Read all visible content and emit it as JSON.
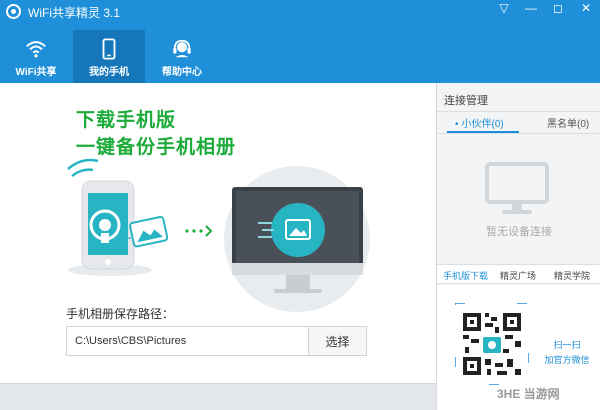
{
  "window": {
    "title": "WiFi共享精灵 3.1",
    "buttons": {
      "menu": "▽",
      "minimize": "—",
      "maximize": "◻",
      "close": "✕"
    }
  },
  "nav": {
    "items": [
      {
        "label": "WiFi共享",
        "icon": "wifi-icon"
      },
      {
        "label": "我的手机",
        "icon": "phone-icon",
        "active": true
      },
      {
        "label": "帮助中心",
        "icon": "headset-icon"
      }
    ]
  },
  "main": {
    "promo_line1": "下载手机版",
    "promo_line2": "一键备份手机相册",
    "path_label": "手机相册保存路径：",
    "path_value": "C:\\Users\\CBS\\Pictures",
    "choose_label": "选择"
  },
  "side": {
    "title": "连接管理",
    "tabs": {
      "partner": "小伙伴(0)",
      "blacklist": "黑名单(0)"
    },
    "no_device": "暂无设备连接",
    "download_tabs": [
      "手机版下载",
      "精灵广场",
      "精灵学院"
    ],
    "scan_line1": "扫一扫",
    "scan_line2": "加官方微信"
  },
  "watermark": "3HE 当游网",
  "colors": {
    "header": "#1e8fd8",
    "accent_green": "#1dab3a",
    "accent_teal": "#28b5c3"
  }
}
